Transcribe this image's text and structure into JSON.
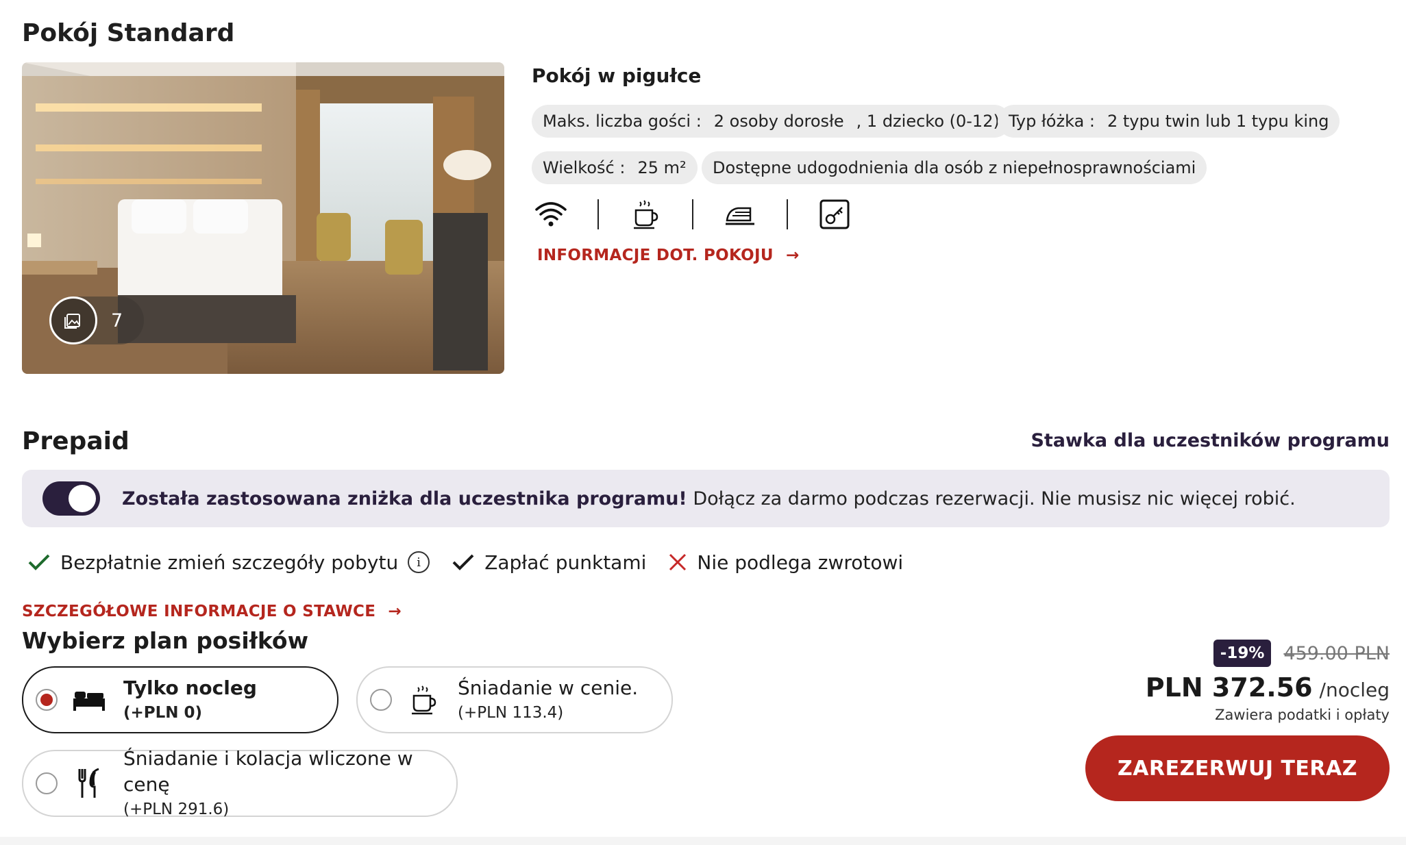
{
  "room": {
    "title": "Pokój Standard",
    "photo_count": "7",
    "nutshell_title": "Pokój w pigułce",
    "chips": {
      "max_guests_label": "Maks. liczba gości :",
      "max_guests_adults": "2 osoby dorosłe",
      "max_guests_children": ", 1 dziecko (0-12)",
      "bed_type_label": "Typ łóżka :",
      "bed_type_value": "2 typu twin lub 1 typu king",
      "size_label": "Wielkość :",
      "size_value": "25 m²",
      "accessibility": "Dostępne udogodnienia dla osób z niepełnosprawnościami"
    },
    "amenity_icons": [
      "wifi-icon",
      "coffee-icon",
      "iron-icon",
      "key-card-icon"
    ],
    "room_info_link": "INFORMACJE DOT. POKOJU"
  },
  "rate": {
    "title": "Prepaid",
    "member_rate_label": "Stawka dla uczestników programu",
    "banner": {
      "toggle_on": true,
      "bold_text": "Została zastosowana zniżka dla uczestnika programu!",
      "text": " Dołącz za darmo podczas rezerwacji. Nie musisz nic więcej robić."
    },
    "features": {
      "change_details": "Bezpłatnie zmień szczegóły pobytu",
      "pay_points": "Zapłać punktami",
      "non_refundable": "Nie podlega zwrotowi"
    },
    "rate_details_link": "SZCZEGÓŁOWE INFORMACJE O STAWCE",
    "meal_plan_title": "Wybierz plan posiłków",
    "meal_options": [
      {
        "name": "Tylko nocleg",
        "price": "(+PLN 0)",
        "selected": true
      },
      {
        "name": "Śniadanie w cenie.",
        "price": "(+PLN 113.4)",
        "selected": false
      },
      {
        "name": "Śniadanie i kolacja wliczone w cenę",
        "price": "(+PLN 291.6)",
        "selected": false
      }
    ],
    "pricing": {
      "discount": "-19%",
      "old_price": "459.00",
      "old_price_currency": "PLN",
      "price": "PLN 372.56",
      "per_night": "/nocleg",
      "tax_note": "Zawiera podatki i opłaty",
      "book_button": "ZAREZERWUJ TERAZ"
    }
  },
  "colors": {
    "accent_red": "#b5261e",
    "brand_purple": "#2a1f3d",
    "check_green": "#1e6b2d",
    "cross_red": "#c62828"
  }
}
